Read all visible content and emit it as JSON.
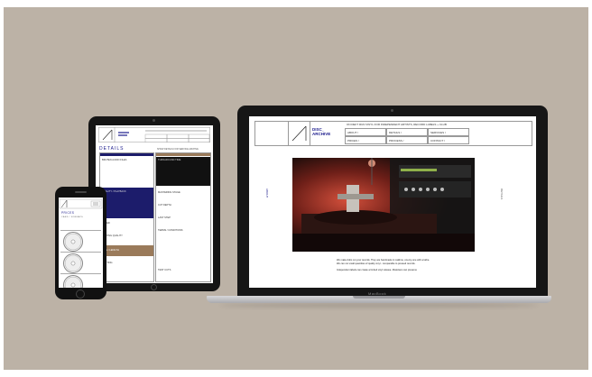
{
  "laptop": {
    "brand": "MacBook",
    "site": {
      "logo_text": "DISC_\nARCHIVE",
      "tagline": "ON DEFT RUN VINYL FOR INDEPENDENT ARTISTS, RECORD LABELS + CLUB",
      "nav": [
        "ABOUT /",
        "DETAILS /",
        "SERVICES /",
        "PRICES /",
        "PROCESS /",
        "CONTACT /"
      ],
      "side_left": "ABOUT",
      "side_right": "DETAILS",
      "body_text": "We make dubs cut your records. They are handmade in realtime, one-by-one with a lathe. We can cut small quantities of quality vinyl - comparable to pressed records.\n\nIndependent labels can create a limited vinyl release. Musicians can preserve"
    }
  },
  "tablet": {
    "site": {
      "title": "DETAILS",
      "subhead": "SHOW DETAILS FOR SERVICE ARCHIVE",
      "cells_a": [
        "BRUTEN AUDIO FILES",
        "QUALITY / PLAYBACK",
        "SPEED",
        "PLAYING QUALITY",
        "TIME / LENGTH",
        "CUTTING"
      ],
      "cells_b": [
        "TURNAROUND TIME",
        "MASTERING STAGE",
        "CUT DEPTH",
        "LAST STEP",
        "TERMS / CONDITIONS",
        "TEST CUTS"
      ]
    }
  },
  "phone": {
    "site": {
      "title": "PRICES",
      "subtitle": "CARD / FORMATS"
    }
  },
  "colors": {
    "backdrop": "#bcb2a6",
    "accent_navy": "#1c1c6b",
    "accent_brown": "#9a7a5a",
    "photo_red": "#c43a2a"
  }
}
